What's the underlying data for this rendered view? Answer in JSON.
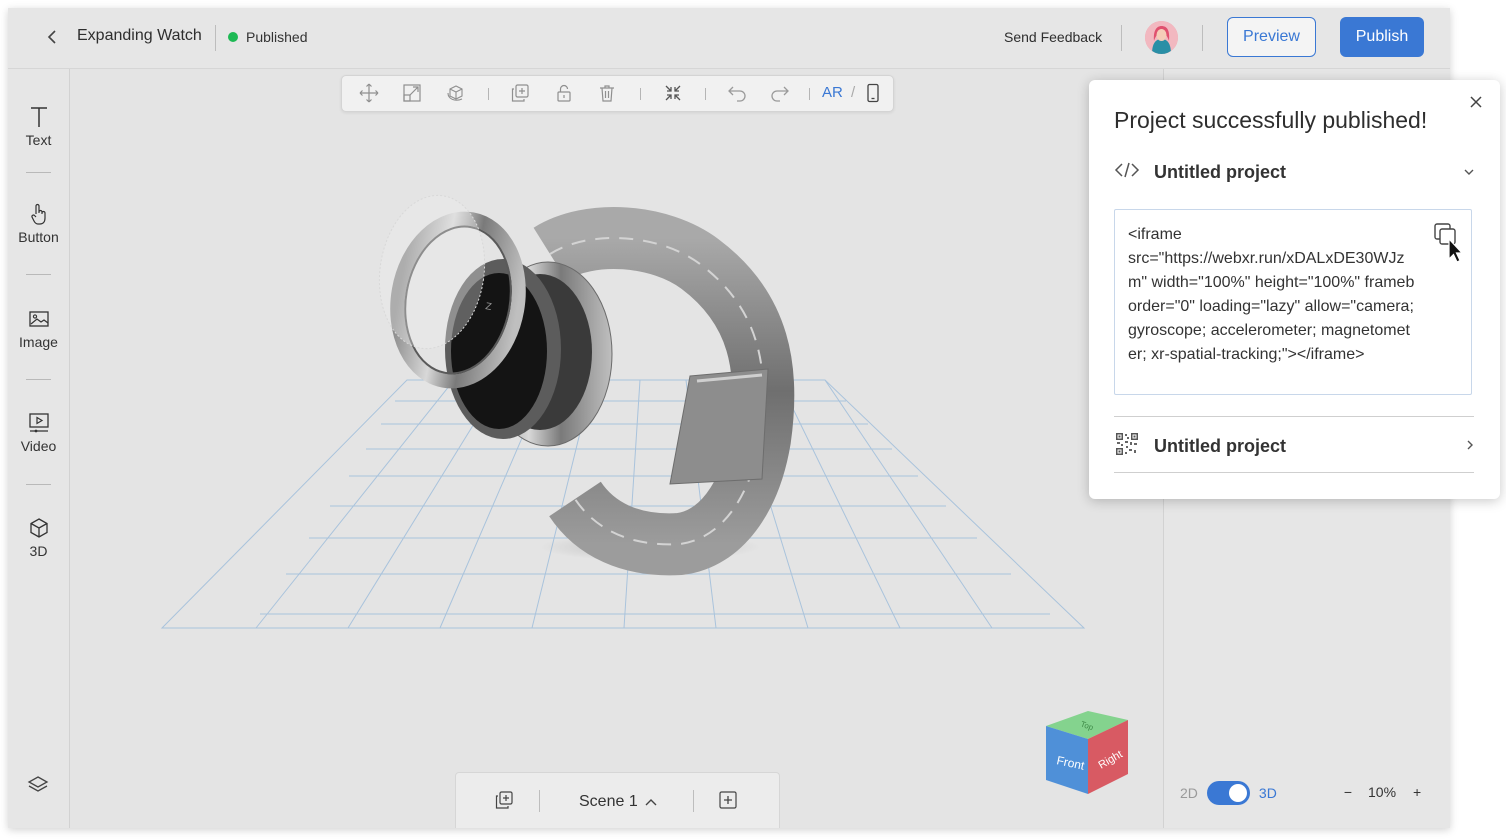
{
  "header": {
    "project_title": "Expanding Watch",
    "status": "Published",
    "feedback": "Send Feedback",
    "preview": "Preview",
    "publish": "Publish"
  },
  "sidebar": {
    "items": [
      {
        "label": "Text",
        "icon": "text-icon"
      },
      {
        "label": "Button",
        "icon": "hand-pointer-icon"
      },
      {
        "label": "Image",
        "icon": "image-icon"
      },
      {
        "label": "Video",
        "icon": "video-icon"
      },
      {
        "label": "3D",
        "icon": "cube-icon"
      }
    ]
  },
  "toolbar": {
    "icons": [
      "move-icon",
      "scale-icon",
      "rotate-icon",
      "duplicate-icon",
      "lock-icon",
      "trash-icon",
      "collapse-icon",
      "undo-icon",
      "redo-icon",
      "phone-icon"
    ],
    "ar_label": "AR",
    "separator": "/"
  },
  "viewcube": {
    "front": "Front",
    "right": "Right",
    "top": "Top"
  },
  "scene": {
    "label": "Scene 1"
  },
  "view_toggle": {
    "option_2d": "2D",
    "option_3d": "3D",
    "selected": "3D"
  },
  "zoom": {
    "minus": "−",
    "value": "10%",
    "plus": "+"
  },
  "popup": {
    "title": "Project successfully published!",
    "embed_item": {
      "label": "Untitled project",
      "icon": "code-icon",
      "expanded": true
    },
    "embed_code": "<iframe\nsrc=\"https://webxr.run/xDALxDE30WJzm\" width=\"100%\" height=\"100%\" frameborder=\"0\" loading=\"lazy\" allow=\"camera; gyroscope; accelerometer; magnetometer; xr-spatial-tracking;\"></iframe>",
    "qr_item": {
      "label": "Untitled project",
      "icon": "qr-code-icon"
    }
  },
  "colors": {
    "accent": "#3a78d4",
    "published_dot": "#1db954"
  }
}
